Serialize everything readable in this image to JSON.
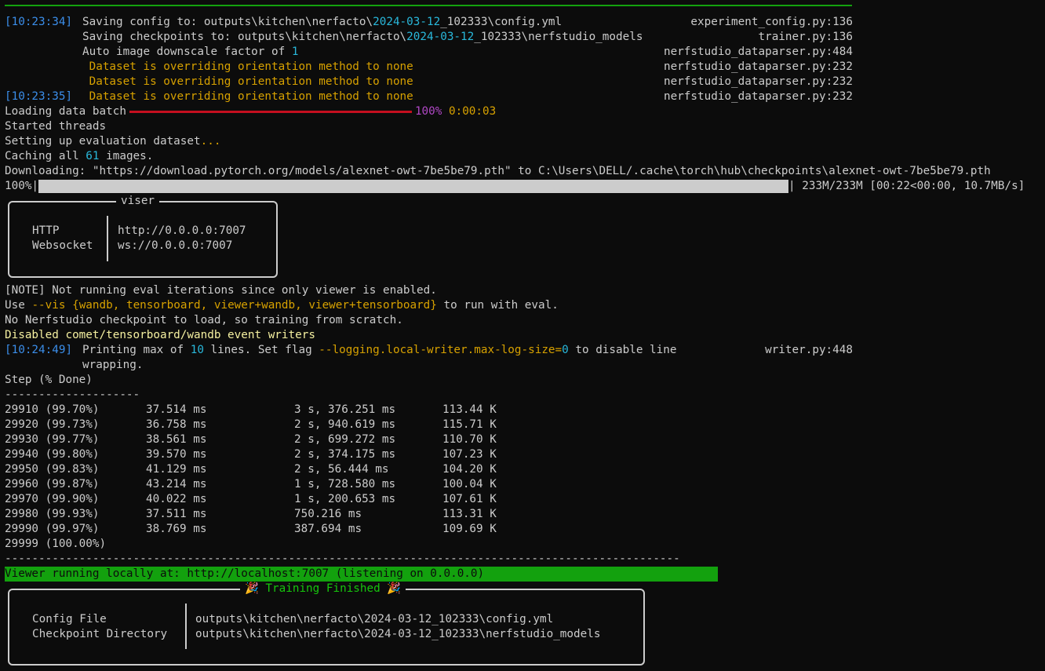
{
  "log": [
    {
      "ts": "[10:23:34]",
      "parts": [
        {
          "t": "Saving config to: outputs\\kitchen\\nerfacto\\"
        },
        {
          "t": "2024-03-12",
          "c": "cy"
        },
        {
          "t": "_102333\\config.yml"
        }
      ],
      "src": "experiment_config.py:136"
    },
    {
      "ts": "",
      "parts": [
        {
          "t": "Saving checkpoints to: outputs\\kitchen\\nerfacto\\"
        },
        {
          "t": "2024-03-12",
          "c": "cy"
        },
        {
          "t": "_102333\\nerfstudio_models"
        }
      ],
      "src": "trainer.py:136"
    },
    {
      "ts": "",
      "parts": [
        {
          "t": "Auto image downscale factor of "
        },
        {
          "t": "1",
          "c": "cy"
        }
      ],
      "src": "nerfstudio_dataparser.py:484"
    },
    {
      "ts": "",
      "parts": [
        {
          "t": " Dataset is overriding orientation method to none",
          "c": "yl"
        }
      ],
      "src": "nerfstudio_dataparser.py:232"
    },
    {
      "ts": "",
      "parts": [
        {
          "t": " Dataset is overriding orientation method to none",
          "c": "yl"
        }
      ],
      "src": "nerfstudio_dataparser.py:232"
    },
    {
      "ts": "[10:23:35]",
      "parts": [
        {
          "t": " Dataset is overriding orientation method to none",
          "c": "yl"
        }
      ],
      "src": "nerfstudio_dataparser.py:232"
    }
  ],
  "loading": {
    "label": "Loading data batch",
    "percent": "100%",
    "time": "0:00:03",
    "progress": 1.0
  },
  "status_lines": [
    "Started threads",
    "Setting up evaluation dataset",
    "Caching all ",
    "Downloading: \"https://download.pytorch.org/models/alexnet-owt-7be5be79.pth\" to C:\\Users\\DELL/.cache\\torch\\hub\\checkpoints\\alexnet-owt-7be5be79.pth"
  ],
  "ellipsis": "...",
  "cache_count": "61",
  "cache_suffix": " images.",
  "download": {
    "percent": "100%|",
    "tail": "| 233M/233M [00:22<00:00, 10.7MB/s]",
    "progress": 1.0
  },
  "viser": {
    "title": "viser",
    "rows": [
      {
        "label": "HTTP",
        "value": "http://0.0.0.0:7007"
      },
      {
        "label": "Websocket",
        "value": "ws://0.0.0.0:7007"
      }
    ]
  },
  "notes": {
    "note": "[NOTE] Not running eval iterations since only viewer is enabled.",
    "use_prefix": "Use ",
    "use_flag": "--vis",
    "use_open": " {",
    "use_opts": "wandb, tensorboard, viewer+wandb, viewer+tensorboard",
    "use_close": "}",
    "use_suffix": " to run with eval.",
    "no_ckpt": "No Nerfstudio checkpoint to load, so training from scratch.",
    "disabled": "Disabled comet/tensorboard/wandb event writers"
  },
  "printing": {
    "ts": "[10:24:49]",
    "a": "Printing max of ",
    "n": "10",
    "b": " lines. Set flag ",
    "flag": "--logging.local-writer.max-log-size=",
    "zero": "0",
    "c": " to disable line",
    "wrap": "wrapping.",
    "src": "writer.py:448"
  },
  "table": {
    "header": "Step (% Done)",
    "underline": "--------------------",
    "rows": [
      {
        "step": "29910 (99.70%)",
        "t1": "37.514 ms",
        "t2": "3 s, 376.251 ms",
        "r": "113.44 K"
      },
      {
        "step": "29920 (99.73%)",
        "t1": "36.758 ms",
        "t2": "2 s, 940.619 ms",
        "r": "115.71 K"
      },
      {
        "step": "29930 (99.77%)",
        "t1": "38.561 ms",
        "t2": "2 s, 699.272 ms",
        "r": "110.70 K"
      },
      {
        "step": "29940 (99.80%)",
        "t1": "39.570 ms",
        "t2": "2 s, 374.175 ms",
        "r": "107.23 K"
      },
      {
        "step": "29950 (99.83%)",
        "t1": "41.129 ms",
        "t2": "2 s, 56.444 ms",
        "r": "104.20 K"
      },
      {
        "step": "29960 (99.87%)",
        "t1": "43.214 ms",
        "t2": "1 s, 728.580 ms",
        "r": "100.04 K"
      },
      {
        "step": "29970 (99.90%)",
        "t1": "40.022 ms",
        "t2": "1 s, 200.653 ms",
        "r": "107.61 K"
      },
      {
        "step": "29980 (99.93%)",
        "t1": "37.511 ms",
        "t2": "750.216 ms",
        "r": "113.31 K"
      },
      {
        "step": "29990 (99.97%)",
        "t1": "38.769 ms",
        "t2": "387.694 ms",
        "r": "109.69 K"
      }
    ],
    "last": "29999 (100.00%)",
    "divider": "----------------------------------------------------------------------------------------------------"
  },
  "viewer_running": "Viewer running locally at: http://localhost:7007 (listening on 0.0.0.0)",
  "finished": {
    "title": "🎉 Training Finished 🎉",
    "rows": [
      {
        "label": "Config File",
        "value": "outputs\\kitchen\\nerfacto\\2024-03-12_102333\\config.yml"
      },
      {
        "label": "Checkpoint Directory",
        "value": "outputs\\kitchen\\nerfacto\\2024-03-12_102333\\nerfstudio_models"
      }
    ]
  }
}
